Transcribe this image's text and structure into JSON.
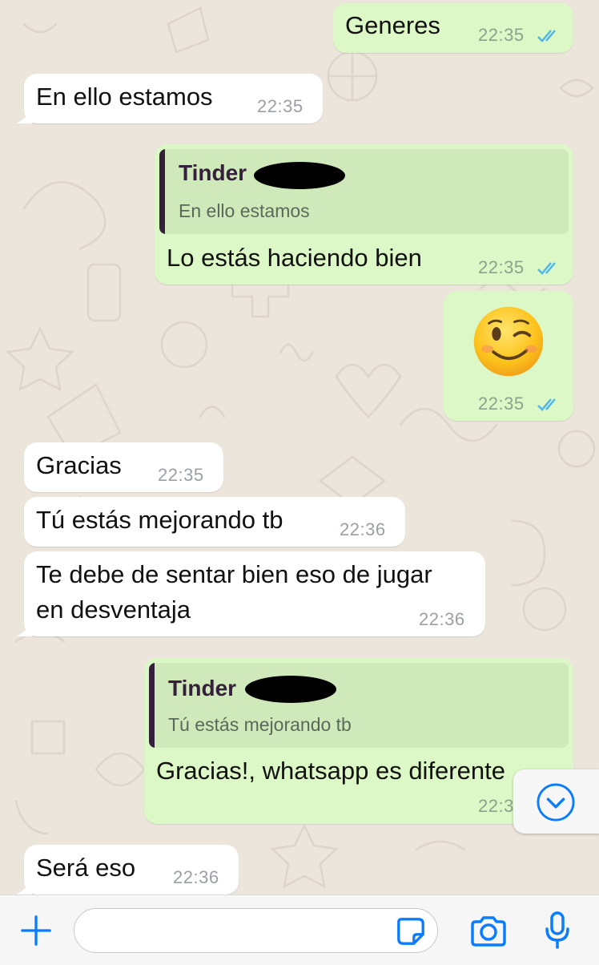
{
  "contact_quote_author": "Tinder",
  "messages": [
    {
      "dir": "out",
      "text": "Generes",
      "time": "22:35",
      "status": "read"
    },
    {
      "dir": "in",
      "text": "En ello estamos",
      "time": "22:35"
    },
    {
      "dir": "out",
      "quote": {
        "author": "Tinder",
        "text": "En ello estamos"
      },
      "text": "Lo estás haciendo bien",
      "time": "22:35",
      "status": "read"
    },
    {
      "dir": "out",
      "emoji": "winking-face",
      "time": "22:35",
      "status": "read"
    },
    {
      "dir": "in",
      "text": "Gracias",
      "time": "22:35"
    },
    {
      "dir": "in",
      "text": "Tú estás mejorando tb",
      "time": "22:36"
    },
    {
      "dir": "in",
      "text_line1": "Te debe de sentar bien eso de jugar",
      "text_line2": "en desventaja",
      "time": "22:36"
    },
    {
      "dir": "out",
      "quote": {
        "author": "Tinder",
        "text": "Tú estás mejorando tb"
      },
      "text": "Gracias!, whatsapp es diferente",
      "time": "22:3"
    },
    {
      "dir": "in",
      "text": "Será eso",
      "time": "22:36"
    }
  ],
  "input_bar": {
    "message_input_value": "",
    "icons": [
      "plus-icon",
      "sticker-icon",
      "camera-icon",
      "microphone-icon"
    ]
  },
  "scroll_down_icon": "chevron-down-circle-icon",
  "colors": {
    "incoming_bubble": "#ffffff",
    "outgoing_bubble": "#dcf8c6",
    "read_ticks": "#4fb6ec",
    "accent": "#0a7cff",
    "quote_bar": "#35203b"
  }
}
